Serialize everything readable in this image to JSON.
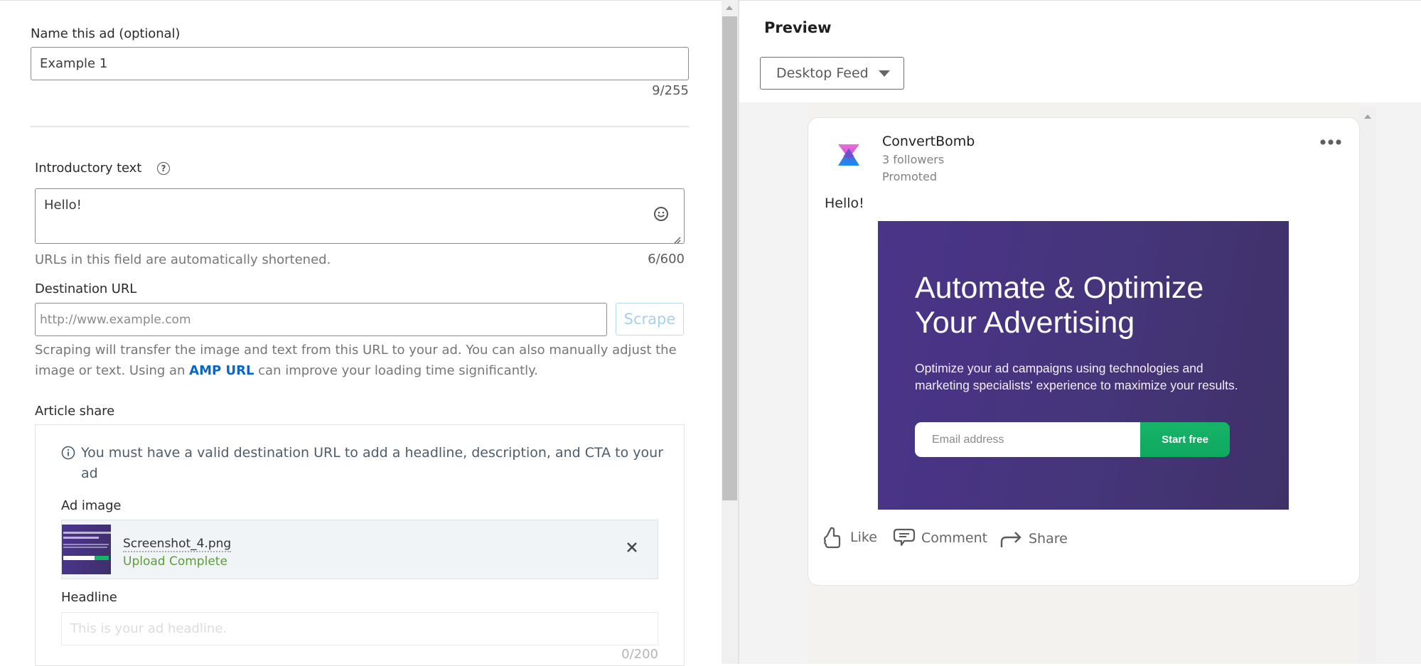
{
  "form": {
    "name_label": "Name this ad (optional)",
    "name_value": "Example 1",
    "name_counter": "9/255",
    "intro_label": "Introductory text",
    "intro_help_icon": "question-circle-icon",
    "intro_value": "Hello!",
    "intro_emoji_icon": "smiley-icon",
    "intro_helper": "URLs in this field are automatically shortened.",
    "intro_counter": "6/600",
    "dest_label": "Destination URL",
    "dest_placeholder": "http://www.example.com",
    "scrape_label": "Scrape",
    "scrape_helper_1": "Scraping will transfer the image and text from this URL to your ad. You can also manually adjust the",
    "scrape_helper_2a": "image or text. Using an ",
    "scrape_helper_link": "AMP URL",
    "scrape_helper_2b": " can improve your loading time significantly.",
    "article_label": "Article share",
    "info_icon": "info-circle-icon",
    "info_text_1": "You must have a valid destination URL to add a headline, description, and CTA to your",
    "info_text_2": "ad",
    "ad_image_label": "Ad image",
    "ad_image_file": "Screenshot_4.png",
    "ad_image_status": "Upload Complete",
    "ad_image_remove_icon": "close-icon",
    "headline_label": "Headline",
    "headline_placeholder": "This is your ad headline.",
    "headline_counter": "0/200"
  },
  "preview": {
    "title": "Preview",
    "view_selected": "Desktop Feed",
    "company": "ConvertBomb",
    "followers": "3 followers",
    "promoted": "Promoted",
    "menu_icon": "more-horizontal-icon",
    "post_text": "Hello!",
    "creative": {
      "headline_1": "Automate & Optimize",
      "headline_2": "Your Advertising",
      "sub_1": "Optimize your ad campaigns using technologies and",
      "sub_2": "marketing specialists' experience to maximize your results.",
      "email_placeholder": "Email address",
      "cta": "Start free"
    },
    "actions": [
      {
        "label": "Like",
        "icon": "thumbs-up-icon"
      },
      {
        "label": "Comment",
        "icon": "comment-icon"
      },
      {
        "label": "Share",
        "icon": "share-arrow-icon"
      }
    ]
  },
  "colors": {
    "link": "#0a66c2",
    "success": "#5a9e3a",
    "cta_green": "#12ad63",
    "creative_purple": "#4a3489"
  }
}
